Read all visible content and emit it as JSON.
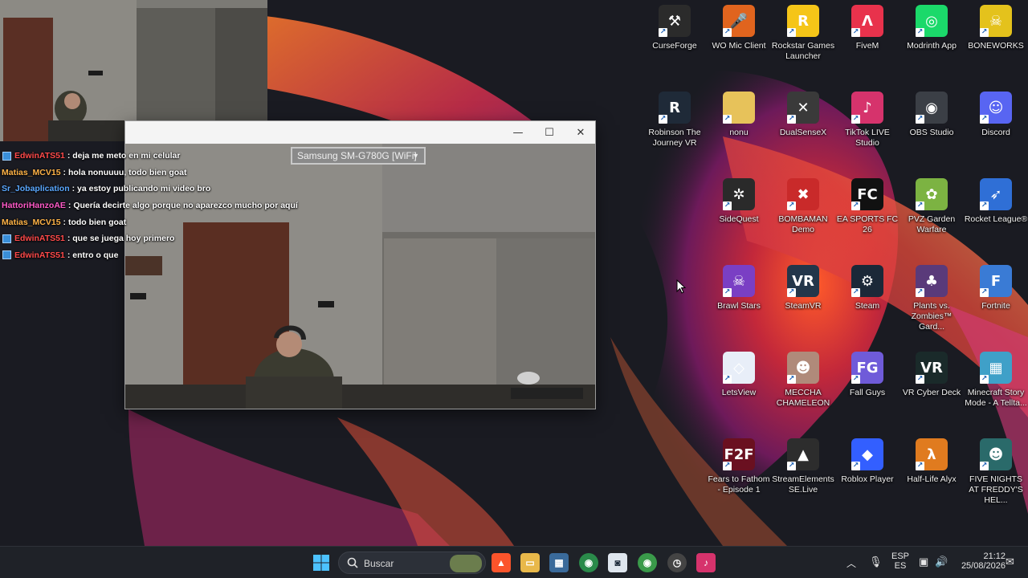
{
  "desktop": {
    "icons": [
      {
        "label": "CurseForge",
        "color": "#2b2b2b",
        "glyph": "⚒"
      },
      {
        "label": "WO Mic Client",
        "color": "#e0641e",
        "glyph": "🎤"
      },
      {
        "label": "Rockstar Games Launcher",
        "color": "#f5c518",
        "glyph": "R"
      },
      {
        "label": "FiveM",
        "color": "#e8324c",
        "glyph": "Λ"
      },
      {
        "label": "Modrinth App",
        "color": "#1bd96a",
        "glyph": "◎"
      },
      {
        "label": "BONEWORKS",
        "color": "#e4c21c",
        "glyph": "☠"
      },
      {
        "label": "Robinson The Journey VR",
        "color": "#1f2a38",
        "glyph": "R"
      },
      {
        "label": "nonu",
        "color": "#e7c25a",
        "glyph": ""
      },
      {
        "label": "DualSenseX",
        "color": "#3a3a3a",
        "glyph": "✕"
      },
      {
        "label": "TikTok LIVE Studio",
        "color": "#d6336c",
        "glyph": "♪"
      },
      {
        "label": "OBS Studio",
        "color": "#3b3f46",
        "glyph": "◉"
      },
      {
        "label": "Discord",
        "color": "#5865f2",
        "glyph": "☺"
      },
      {
        "label": "SideQuest",
        "color": "#2a2a2a",
        "glyph": "✲"
      },
      {
        "label": "BOMBAMAN Demo",
        "color": "#c92a2a",
        "glyph": "✖"
      },
      {
        "label": "EA SPORTS FC 26",
        "color": "#111111",
        "glyph": "FC"
      },
      {
        "label": "PVZ Garden Warfare",
        "color": "#7cb342",
        "glyph": "✿"
      },
      {
        "label": "Rocket League®",
        "color": "#2f6fd6",
        "glyph": "➶"
      },
      {
        "label": "Brawl Stars",
        "color": "#7a3fc4",
        "glyph": "☠"
      },
      {
        "label": "SteamVR",
        "color": "#23364a",
        "glyph": "VR"
      },
      {
        "label": "Steam",
        "color": "#1b2838",
        "glyph": "⚙"
      },
      {
        "label": "Plants vs. Zombies™ Gard...",
        "color": "#5a3a7a",
        "glyph": "♣"
      },
      {
        "label": "Fortnite",
        "color": "#3a7bd5",
        "glyph": "F"
      },
      {
        "label": "LetsView",
        "color": "#e8eef8",
        "glyph": "◇"
      },
      {
        "label": "MECCHA CHAMELEON",
        "color": "#b08a7a",
        "glyph": "☻"
      },
      {
        "label": "Fall Guys",
        "color": "#6f5bd9",
        "glyph": "FG"
      },
      {
        "label": "VR Cyber Deck",
        "color": "#1a2a2a",
        "glyph": "VR"
      },
      {
        "label": "Minecraft Story Mode - A Tellta...",
        "color": "#3fa0c8",
        "glyph": "▦"
      },
      {
        "label": "Fears to Fathom - Episode 1",
        "color": "#6a1020",
        "glyph": "F2F"
      },
      {
        "label": "StreamElements SE.Live",
        "color": "#2d2d2d",
        "glyph": "▲"
      },
      {
        "label": "Roblox Player",
        "color": "#335fff",
        "glyph": "◆"
      },
      {
        "label": "Half-Life Alyx",
        "color": "#e07b1f",
        "glyph": "λ"
      },
      {
        "label": "FIVE NIGHTS AT FREDDY'S HEL...",
        "color": "#2a6a6a",
        "glyph": "☻"
      }
    ]
  },
  "window": {
    "device_select": "Samsung SM-G780G [WiFi]",
    "minimize_glyph": "—",
    "maximize_glyph": "☐",
    "close_glyph": "✕"
  },
  "chat": {
    "lines": [
      {
        "user": "EdwinATS51",
        "msg": ": deja me meto en mi celular",
        "color": "#ff4a4a",
        "badge": true
      },
      {
        "user": "Matias_MCV15",
        "msg": ": hola nonuuuu, todo bien goat",
        "color": "#ffb347",
        "badge": false
      },
      {
        "user": "Sr_Jobaplication",
        "msg": ": ya estoy publicando mi video bro",
        "color": "#5aa8ff",
        "badge": false
      },
      {
        "user": "HattoriHanzoAE",
        "msg": ": Quería decirte algo porque no aparezco mucho por aquí",
        "color": "#ff5ac8",
        "badge": false
      },
      {
        "user": "Matias_MCV15",
        "msg": ": todo bien goat",
        "color": "#ffb347",
        "badge": false
      },
      {
        "user": "EdwinATS51",
        "msg": ": que se juega hoy primero",
        "color": "#ff4a4a",
        "badge": true
      },
      {
        "user": "EdwinATS51",
        "msg": ": entro o que",
        "color": "#ff4a4a",
        "badge": true
      }
    ]
  },
  "taskbar": {
    "search_label": "Buscar",
    "lang_top": "ESP",
    "lang_bottom": "ES",
    "time": "21:12",
    "date": "25/08/2026"
  }
}
